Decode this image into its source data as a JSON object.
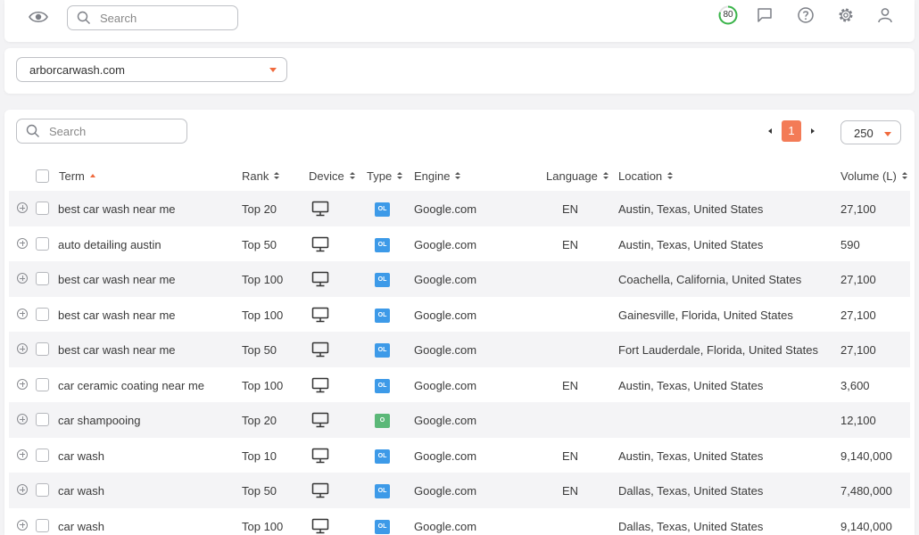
{
  "topbar": {
    "search_placeholder": "Search",
    "score": "80",
    "icons": [
      "eye-icon",
      "search-icon",
      "score-ring-icon",
      "chat-icon",
      "help-icon",
      "gear-icon",
      "user-icon"
    ],
    "score_color": "#3ab54a"
  },
  "domain": {
    "selected": "arborcarwash.com"
  },
  "table": {
    "search_placeholder": "Search",
    "pagination": {
      "current_page": "1"
    },
    "per_page": "250",
    "columns": {
      "term": "Term",
      "rank": "Rank",
      "device": "Device",
      "type": "Type",
      "engine": "Engine",
      "language": "Language",
      "location": "Location",
      "volume": "Volume (L)"
    },
    "rows": [
      {
        "term": "best car wash near me",
        "rank": "Top 20",
        "type": "OL",
        "engine": "Google.com",
        "language": "EN",
        "location": "Austin, Texas, United States",
        "volume": "27,100"
      },
      {
        "term": "auto detailing austin",
        "rank": "Top 50",
        "type": "OL",
        "engine": "Google.com",
        "language": "EN",
        "location": "Austin, Texas, United States",
        "volume": "590"
      },
      {
        "term": "best car wash near me",
        "rank": "Top 100",
        "type": "OL",
        "engine": "Google.com",
        "language": "",
        "location": "Coachella, California, United States",
        "volume": "27,100"
      },
      {
        "term": "best car wash near me",
        "rank": "Top 100",
        "type": "OL",
        "engine": "Google.com",
        "language": "",
        "location": "Gainesville, Florida, United States",
        "volume": "27,100"
      },
      {
        "term": "best car wash near me",
        "rank": "Top 50",
        "type": "OL",
        "engine": "Google.com",
        "language": "",
        "location": "Fort Lauderdale, Florida, United States",
        "volume": "27,100"
      },
      {
        "term": "car ceramic coating near me",
        "rank": "Top 100",
        "type": "OL",
        "engine": "Google.com",
        "language": "EN",
        "location": "Austin, Texas, United States",
        "volume": "3,600"
      },
      {
        "term": "car shampooing",
        "rank": "Top 20",
        "type": "O",
        "engine": "Google.com",
        "language": "",
        "location": "",
        "volume": "12,100"
      },
      {
        "term": "car wash",
        "rank": "Top 10",
        "type": "OL",
        "engine": "Google.com",
        "language": "EN",
        "location": "Austin, Texas, United States",
        "volume": "9,140,000"
      },
      {
        "term": "car wash",
        "rank": "Top 50",
        "type": "OL",
        "engine": "Google.com",
        "language": "EN",
        "location": "Dallas, Texas, United States",
        "volume": "7,480,000"
      },
      {
        "term": "car wash",
        "rank": "Top 100",
        "type": "OL",
        "engine": "Google.com",
        "language": "",
        "location": "Dallas, Texas, United States",
        "volume": "9,140,000"
      }
    ]
  },
  "colors": {
    "accent": "#f37b57",
    "type_ol": "#3d9ae8",
    "type_o": "#5bb878"
  }
}
